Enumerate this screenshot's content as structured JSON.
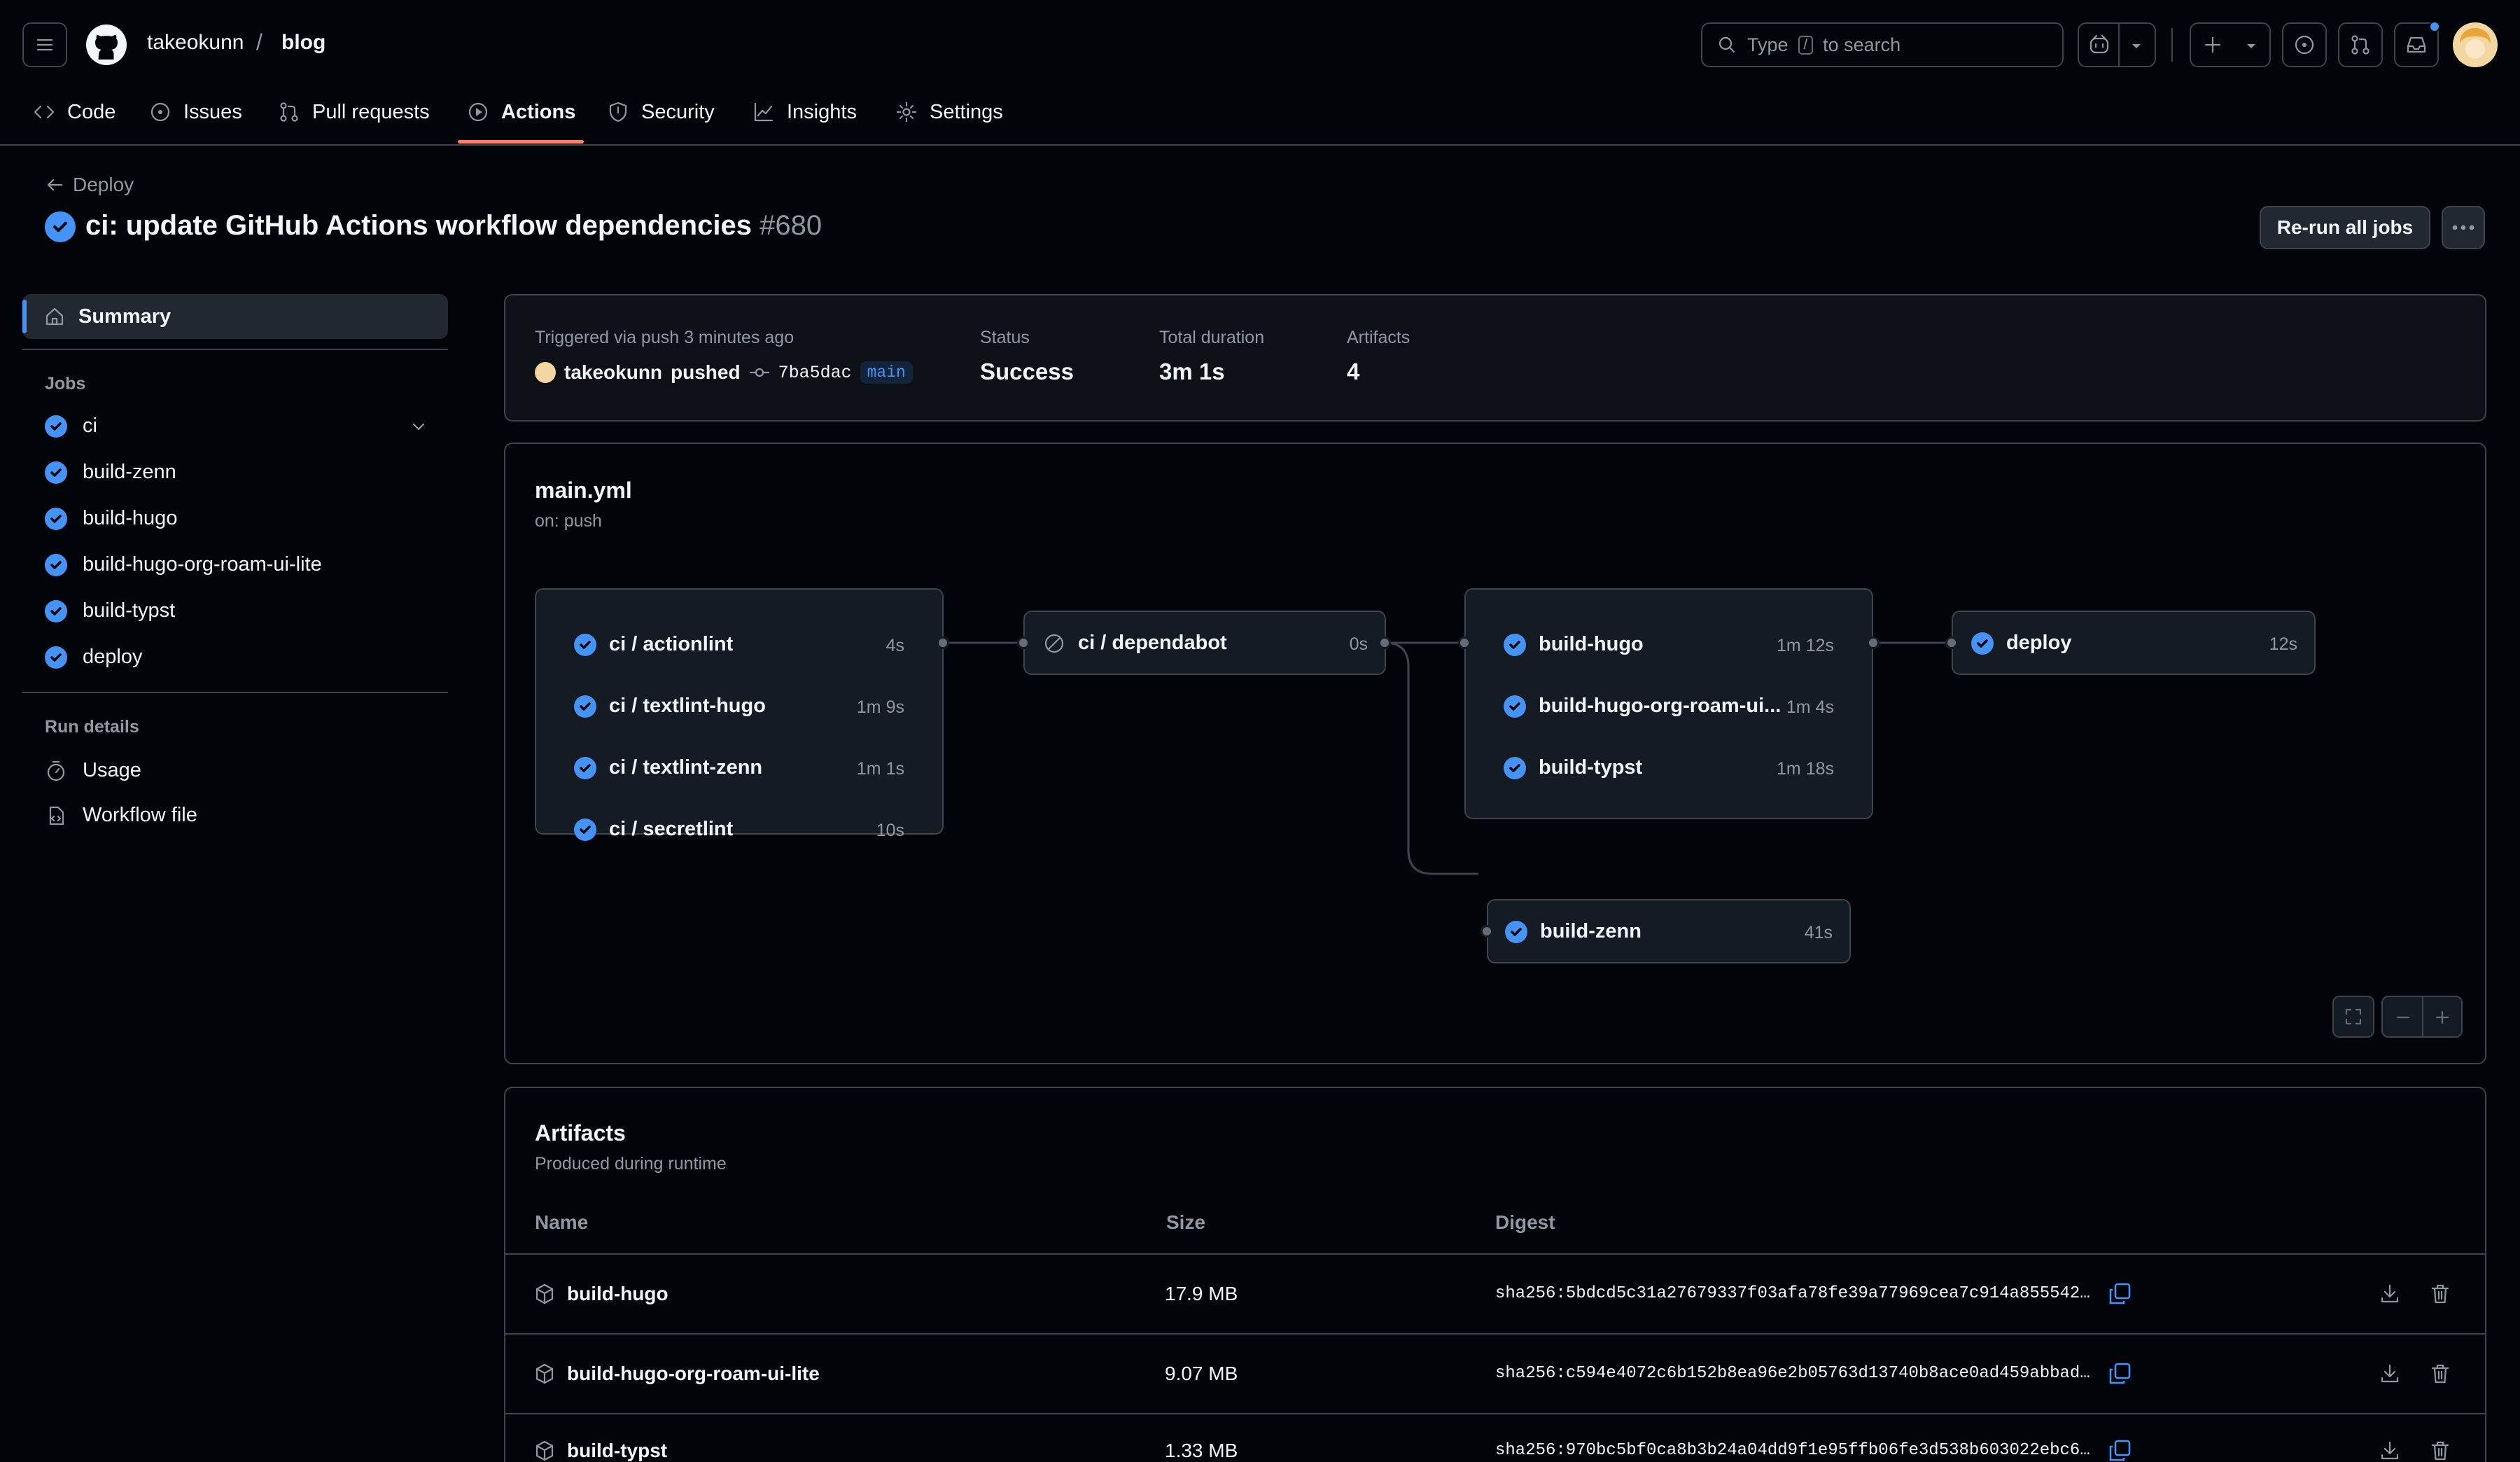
{
  "header": {
    "owner": "takeokunn",
    "separator": "/",
    "repo": "blog",
    "search": {
      "prefix": "Type",
      "key": "/",
      "suffix": "to search"
    },
    "icons": [
      "hamburger-icon",
      "github-logo-icon",
      "search-icon",
      "copilot-icon",
      "chevron-down-icon",
      "plus-icon",
      "issue-icon",
      "pull-request-icon",
      "inbox-icon",
      "avatar"
    ]
  },
  "nav": {
    "tabs": [
      {
        "label": "Code",
        "icon": "code-icon"
      },
      {
        "label": "Issues",
        "icon": "issue-opened-icon"
      },
      {
        "label": "Pull requests",
        "icon": "git-pull-request-icon"
      },
      {
        "label": "Actions",
        "icon": "play-icon",
        "selected": true
      },
      {
        "label": "Security",
        "icon": "shield-icon"
      },
      {
        "label": "Insights",
        "icon": "graph-icon"
      },
      {
        "label": "Settings",
        "icon": "gear-icon"
      }
    ]
  },
  "run": {
    "back_label": "Deploy",
    "title": "ci: update GitHub Actions workflow dependencies",
    "number": "#680",
    "rerun_label": "Re-run all jobs",
    "more_label": "···"
  },
  "sidebar": {
    "summary_label": "Summary",
    "jobs_heading": "Jobs",
    "jobs": [
      {
        "label": "ci"
      },
      {
        "label": "build-zenn"
      },
      {
        "label": "build-hugo"
      },
      {
        "label": "build-hugo-org-roam-ui-lite"
      },
      {
        "label": "build-typst"
      },
      {
        "label": "deploy"
      }
    ],
    "run_details_heading": "Run details",
    "usage_label": "Usage",
    "workflow_file_label": "Workflow file"
  },
  "summary": {
    "trigger_text": "Triggered via push 3 minutes ago",
    "actor": "takeokunn",
    "action": "pushed",
    "commit": "7ba5dac",
    "branch": "main",
    "status_label": "Status",
    "status_value": "Success",
    "duration_label": "Total duration",
    "duration_value": "3m 1s",
    "artifacts_label": "Artifacts",
    "artifacts_value": "4"
  },
  "graph": {
    "file": "main.yml",
    "trigger": "on: push",
    "ci_group": [
      {
        "name": "ci / actionlint",
        "duration": "4s"
      },
      {
        "name": "ci / textlint-hugo",
        "duration": "1m 9s"
      },
      {
        "name": "ci / textlint-zenn",
        "duration": "1m 1s"
      },
      {
        "name": "ci / secretlint",
        "duration": "10s"
      }
    ],
    "dependabot": {
      "name": "ci / dependabot",
      "duration": "0s",
      "status": "skipped"
    },
    "build_group": [
      {
        "name": "build-hugo",
        "duration": "1m 12s"
      },
      {
        "name": "build-hugo-org-roam-ui...",
        "duration": "1m 4s"
      },
      {
        "name": "build-typst",
        "duration": "1m 18s"
      }
    ],
    "deploy": {
      "name": "deploy",
      "duration": "12s"
    },
    "zenn": {
      "name": "build-zenn",
      "duration": "41s"
    }
  },
  "artifacts": {
    "title": "Artifacts",
    "subtitle": "Produced during runtime",
    "columns": {
      "name": "Name",
      "size": "Size",
      "digest": "Digest"
    },
    "rows": [
      {
        "name": "build-hugo",
        "size": "17.9 MB",
        "digest": "sha256:5bdcd5c31a27679337f03afa78fe39a77969cea7c914a855542…"
      },
      {
        "name": "build-hugo-org-roam-ui-lite",
        "size": "9.07 MB",
        "digest": "sha256:c594e4072c6b152b8ea96e2b05763d13740b8ace0ad459abbad…"
      },
      {
        "name": "build-typst",
        "size": "1.33 MB",
        "digest": "sha256:970bc5bf0ca8b3b24a04dd9f1e95ffb06fe3d538b603022ebc6…"
      }
    ]
  },
  "colors": {
    "accent": "#4493f8",
    "tab_underline": "#f78166",
    "border": "#3d444d",
    "bg": "#010409",
    "surface": "#151b23"
  }
}
